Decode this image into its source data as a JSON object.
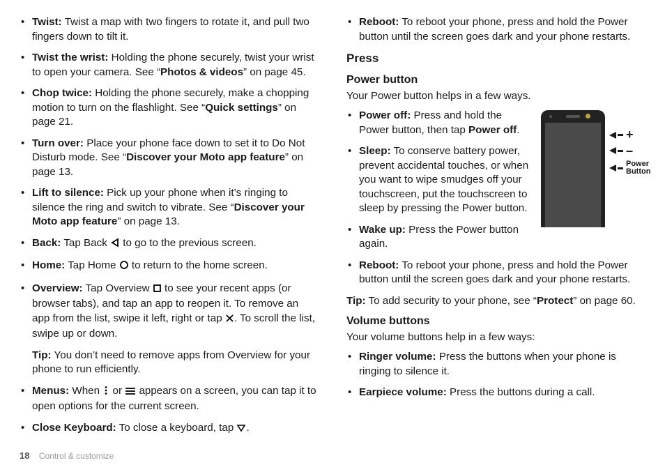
{
  "footer": {
    "page_number": "18",
    "section": "Control & customize"
  },
  "left": {
    "items": [
      {
        "term": "Twist:",
        "rest": " Twist a map with two fingers to rotate it, and pull two fingers down to tilt it."
      },
      {
        "term": "Twist the wrist:",
        "seg1": " Holding the phone securely, twist your wrist to open your camera. See “",
        "bold1": "Photos & videos",
        "seg2": "” on page 45."
      },
      {
        "term": "Chop twice:",
        "seg1": " Holding the phone securely, make a chopping motion to turn on the flashlight. See “",
        "bold1": "Quick settings",
        "seg2": "” on page 21."
      },
      {
        "term": "Turn over:",
        "seg1": " Place your phone face down to set it to Do Not Disturb mode. See “",
        "bold1": "Discover your Moto app feature",
        "seg2": "” on page 13."
      },
      {
        "term": "Lift to silence:",
        "seg1": " Pick up your phone when it’s ringing to silence the ring and switch to vibrate. See “",
        "bold1": "Discover your Moto app feature",
        "seg2": "” on page 13."
      },
      {
        "term": "Back:",
        "seg1": " Tap Back ",
        "icon": "back",
        "seg2": " to go to the previous screen."
      },
      {
        "term": "Home:",
        "seg1": " Tap Home ",
        "icon": "home",
        "seg2": " to return to the home screen."
      },
      {
        "term": "Overview:",
        "seg1": " Tap Overview ",
        "icon": "overview",
        "seg2": " to see your recent apps (or browser tabs), and tap an app to reopen it. To remove an app from the list, swipe it left, right or tap ",
        "icon2": "close",
        "seg3": ". To scroll the list, swipe up or down."
      },
      {
        "tiplabel": "Tip:",
        "tiptext": " You don’t need to remove apps from Overview for your phone to run efficiently."
      },
      {
        "term": "Menus:",
        "seg1": " When ",
        "icon": "dots",
        "seg1b": " or ",
        "icon2": "hamburger",
        "seg2": " appears on a screen, you can tap it to open options for the current screen."
      },
      {
        "term": "Close Keyboard:",
        "seg1": " To close a keyboard, tap ",
        "icon": "keyboard-down",
        "seg2": "."
      }
    ]
  },
  "right": {
    "top_item": {
      "term": "Reboot:",
      "rest": " To reboot your phone, press and hold the Power button until the screen goes dark and your phone restarts."
    },
    "press_heading": "Press",
    "power_heading": "Power button",
    "power_lead": "Your Power button helps in a few ways.",
    "power_items": [
      {
        "term": "Power off:",
        "seg1": " Press and hold the Power button, then tap ",
        "bold1": "Power off",
        "seg2": "."
      },
      {
        "term": "Sleep:",
        "rest": " To conserve battery power, prevent accidental touches, or when you want to wipe smudges off your touchscreen, put the touchscreen to sleep by pressing the Power button."
      },
      {
        "term": "Wake up:",
        "rest": " Press the Power button again."
      },
      {
        "term": "Reboot:",
        "rest": " To reboot your phone, press and hold the Power button until the screen goes dark and your phone restarts."
      }
    ],
    "tip_label": "Tip:",
    "tip_seg1": " To add security to your phone, see “",
    "tip_bold": "Protect",
    "tip_seg2": "” on page 60.",
    "volume_heading": "Volume buttons",
    "volume_lead": "Your volume buttons help in a few ways:",
    "volume_items": [
      {
        "term": "Ringer volume:",
        "rest": " Press the buttons when your phone is ringing to silence it."
      },
      {
        "term": "Earpiece volume:",
        "rest": " Press the buttons during a call."
      }
    ],
    "fig": {
      "plus": "+",
      "minus": "–",
      "power_label_1": "Power",
      "power_label_2": "Button"
    }
  }
}
